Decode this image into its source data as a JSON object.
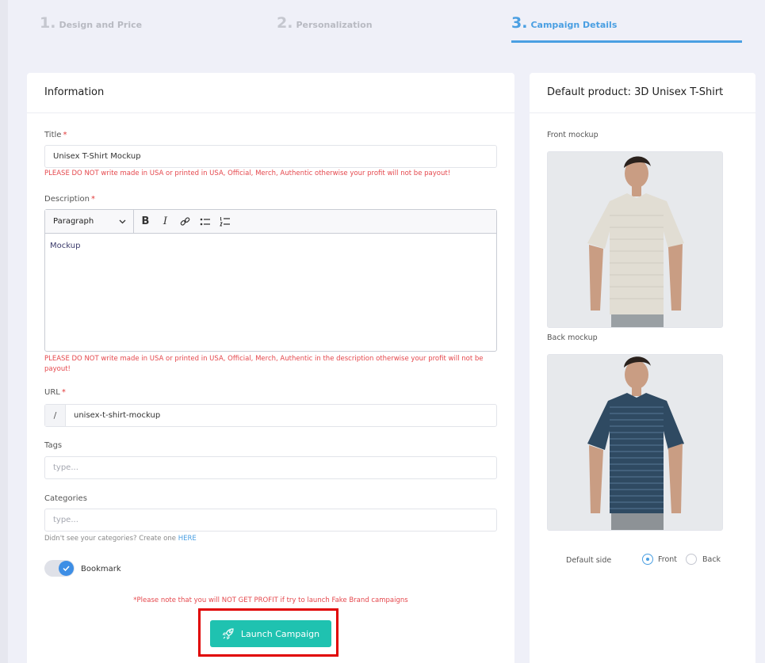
{
  "steps": [
    {
      "num": "1.",
      "label": "Design and Price"
    },
    {
      "num": "2.",
      "label": "Personalization"
    },
    {
      "num": "3.",
      "label": "Campaign Details"
    }
  ],
  "info": {
    "header": "Information",
    "title_label": "Title",
    "required_mark": "*",
    "title_value": "Unisex T-Shirt Mockup",
    "title_warning": "PLEASE DO NOT write made in USA or printed in USA, Official, Merch, Authentic otherwise your profit will not be payout!",
    "description_label": "Description",
    "paragraph_select": "Paragraph",
    "description_value": "Mockup",
    "description_warning": "PLEASE DO NOT write made in USA or printed in USA, Official, Merch, Authentic in the description otherwise your profit will not be payout!",
    "url_label": "URL",
    "url_prefix": "/",
    "url_value": "unisex-t-shirt-mockup",
    "tags_label": "Tags",
    "tags_placeholder": "type...",
    "categories_label": "Categories",
    "categories_placeholder": "type...",
    "categories_hint": "Didn't see your categories? Create one",
    "categories_hint_link": "HERE",
    "bookmark_label": "Bookmark",
    "profit_note": "*Please note that you will NOT GET PROFIT if try to launch Fake Brand campaigns",
    "launch_label": "Launch Campaign"
  },
  "product": {
    "header": "Default product: 3D Unisex T-Shirt",
    "front_label": "Front mockup",
    "back_label": "Back mockup",
    "default_side_label": "Default side",
    "options": [
      "Front",
      "Back"
    ],
    "selected": "Front"
  },
  "colors": {
    "accent": "#4a9fe2",
    "launch": "#1fc2b0",
    "warning": "#e5484d",
    "highlight_frame": "#e00000"
  }
}
